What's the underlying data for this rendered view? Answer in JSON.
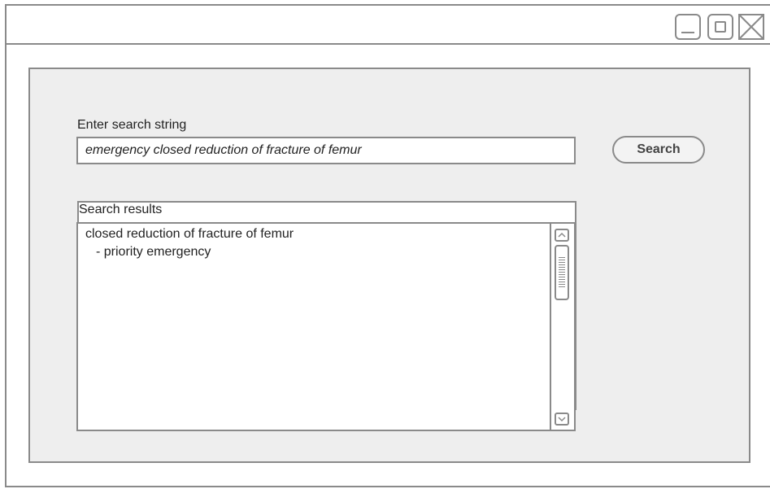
{
  "window": {
    "controls": [
      "minimize-icon",
      "maximize-icon",
      "close-icon"
    ]
  },
  "search": {
    "label": "Enter search string",
    "value": "emergency closed reduction of fracture of femur",
    "button_label": "Search"
  },
  "results": {
    "label": "Search results",
    "items": [
      "closed reduction of fracture of femur",
      "- priority emergency"
    ]
  },
  "colors": {
    "border": "#8a8a8a",
    "panel_background": "#eeeeee"
  }
}
